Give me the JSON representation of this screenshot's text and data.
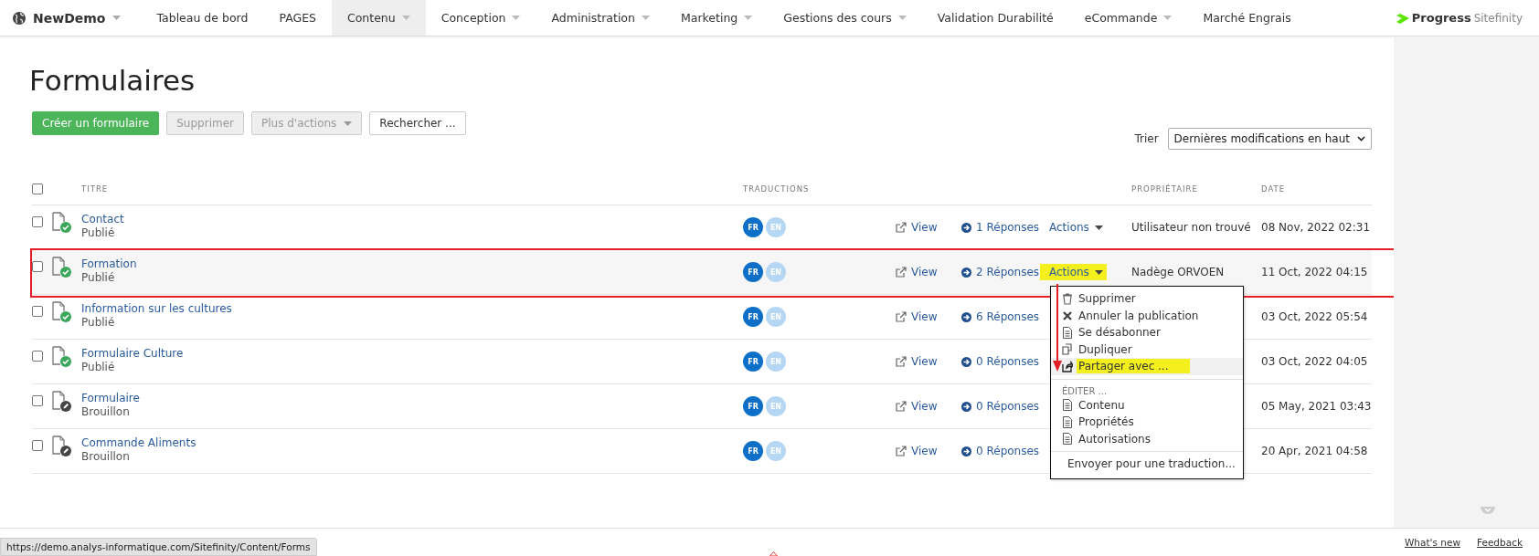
{
  "nav": {
    "site": "NewDemo",
    "items": [
      {
        "label": "Tableau de bord",
        "has_menu": false,
        "selected": false
      },
      {
        "label": "PAGES",
        "has_menu": false,
        "selected": false
      },
      {
        "label": "Contenu",
        "has_menu": true,
        "selected": true
      },
      {
        "label": "Conception",
        "has_menu": true,
        "selected": false
      },
      {
        "label": "Administration",
        "has_menu": true,
        "selected": false
      },
      {
        "label": "Marketing",
        "has_menu": true,
        "selected": false
      },
      {
        "label": "Gestions des cours",
        "has_menu": true,
        "selected": false
      },
      {
        "label": "Validation Durabilité",
        "has_menu": false,
        "selected": false
      },
      {
        "label": "eCommande",
        "has_menu": true,
        "selected": false
      },
      {
        "label": "Marché Engrais",
        "has_menu": false,
        "selected": false
      }
    ],
    "brand": {
      "name": "Progress",
      "product": "Sitefinity"
    }
  },
  "page_title": "Formulaires",
  "toolbar": [
    {
      "label": "Créer un formulaire",
      "kind": "primary",
      "disabled": false,
      "has_menu": false
    },
    {
      "label": "Supprimer",
      "kind": "default",
      "disabled": true,
      "has_menu": false
    },
    {
      "label": "Plus d'actions",
      "kind": "default",
      "disabled": true,
      "has_menu": true
    },
    {
      "label": "Rechercher ...",
      "kind": "default",
      "disabled": false,
      "has_menu": false
    }
  ],
  "sort": {
    "label": "Trier",
    "value": "Dernières modifications en haut"
  },
  "table": {
    "select_all_checked": false,
    "columns": {
      "title": "TITRE",
      "translations": "TRADUCTIONS",
      "owner": "PROPRIÉTAIRE",
      "date": "DATE"
    },
    "rows": [
      {
        "title": "Contact",
        "status": "Publié",
        "kind": "published",
        "checked": false,
        "selected": false,
        "translations": [
          {
            "code": "FR",
            "available": true
          },
          {
            "code": "EN",
            "available": false
          }
        ],
        "view": "View",
        "responses": "1 Réponses",
        "actions": "Actions",
        "actions_open": false,
        "owner": "Utilisateur non trouvé",
        "date": "08 Nov, 2022 02:31"
      },
      {
        "title": "Formation",
        "status": "Publié",
        "kind": "published",
        "checked": false,
        "selected": true,
        "translations": [
          {
            "code": "FR",
            "available": true
          },
          {
            "code": "EN",
            "available": false
          }
        ],
        "view": "View",
        "responses": "2 Réponses",
        "actions": "Actions",
        "actions_open": true,
        "owner": "Nadège ORVOEN",
        "date": "11 Oct, 2022 04:15"
      },
      {
        "title": "Information sur les cultures",
        "status": "Publié",
        "kind": "published",
        "checked": false,
        "selected": false,
        "translations": [
          {
            "code": "FR",
            "available": true
          },
          {
            "code": "EN",
            "available": false
          }
        ],
        "view": "View",
        "responses": "6 Réponses",
        "date": "03 Oct, 2022 05:54"
      },
      {
        "title": "Formulaire Culture",
        "status": "Publié",
        "kind": "published",
        "checked": false,
        "selected": false,
        "translations": [
          {
            "code": "FR",
            "available": true
          },
          {
            "code": "EN",
            "available": false
          }
        ],
        "view": "View",
        "responses": "0 Réponses",
        "date": "03 Oct, 2022 04:05"
      },
      {
        "title": "Formulaire",
        "status": "Brouillon",
        "kind": "draft",
        "checked": false,
        "selected": false,
        "translations": [
          {
            "code": "FR",
            "available": true
          },
          {
            "code": "EN",
            "available": false
          }
        ],
        "view": "View",
        "responses": "0 Réponses",
        "date": "05 May, 2021 03:43"
      },
      {
        "title": "Commande Aliments",
        "status": "Brouillon",
        "kind": "draft",
        "checked": false,
        "selected": false,
        "translations": [
          {
            "code": "FR",
            "available": true
          },
          {
            "code": "EN",
            "available": false
          }
        ],
        "view": "View",
        "responses": "0 Réponses",
        "date": "20 Apr, 2021 04:58"
      }
    ]
  },
  "actions_menu": {
    "sections": [
      {
        "items": [
          {
            "label": "Supprimer",
            "kind": "trash",
            "selected": false
          },
          {
            "label": "Annuler la publication",
            "kind": "cross",
            "selected": false
          },
          {
            "label": "Se désabonner",
            "kind": "document",
            "selected": false
          },
          {
            "label": "Dupliquer",
            "kind": "copy",
            "selected": false
          },
          {
            "label": "Partager avec ...",
            "kind": "share",
            "selected": true
          }
        ]
      },
      {
        "header": "ÉDITER ...",
        "items": [
          {
            "label": "Contenu",
            "kind": "document",
            "selected": false
          },
          {
            "label": "Propriétés",
            "kind": "document",
            "selected": false
          },
          {
            "label": "Autorisations",
            "kind": "document",
            "selected": false
          }
        ]
      },
      {
        "items": [
          {
            "label": "Envoyer pour une traduction...",
            "kind": "translate",
            "selected": false
          }
        ]
      }
    ]
  },
  "footer": {
    "status_url": "https://demo.analys-informatique.com/Sitefinity/Content/Forms",
    "links": [
      "What's new",
      "Feedback"
    ]
  }
}
